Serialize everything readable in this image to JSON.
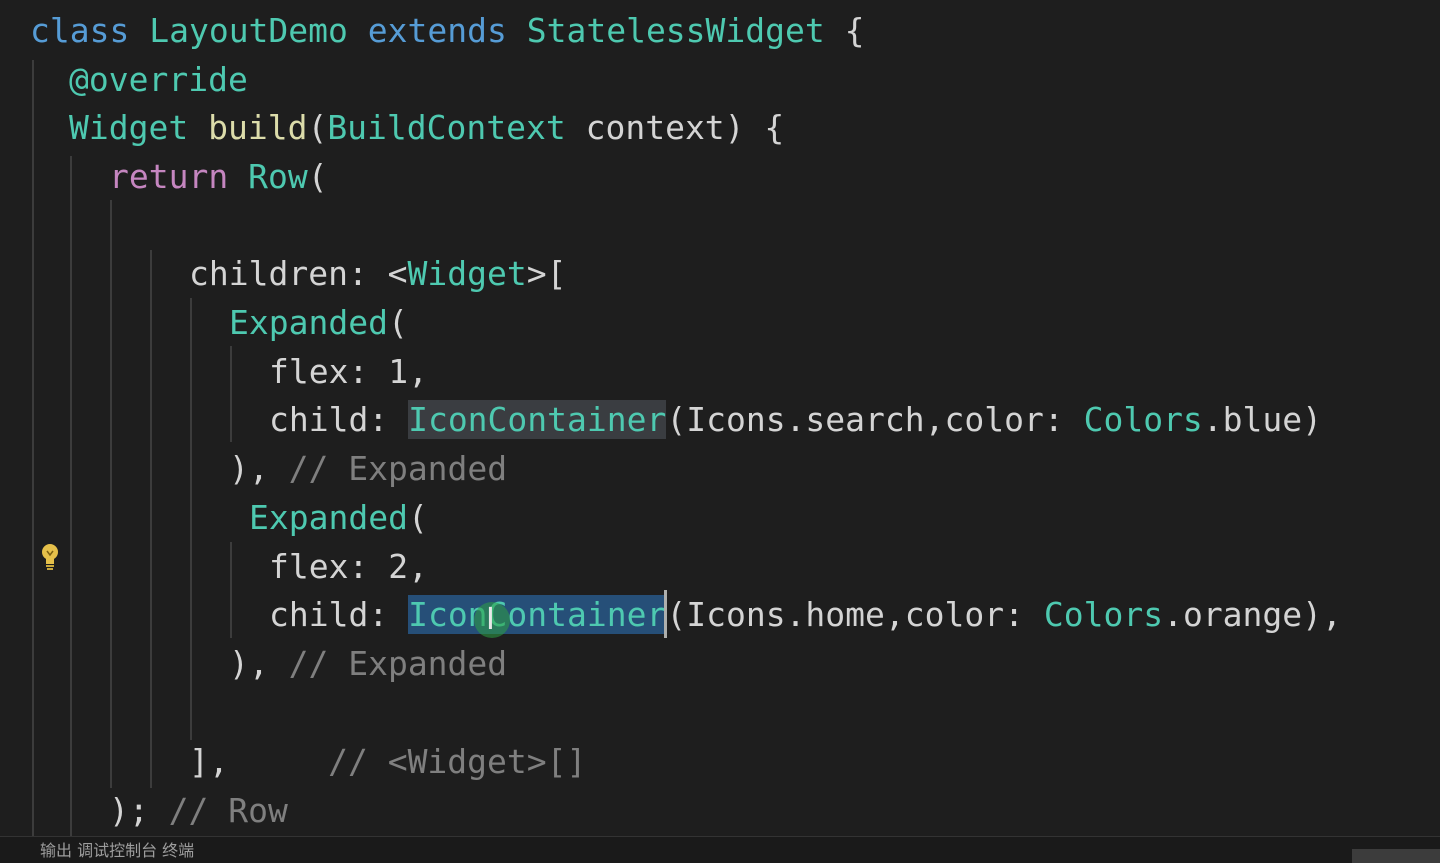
{
  "editor": {
    "language": "dart",
    "lines": [
      {
        "tokens": [
          "class",
          " ",
          "LayoutDemo",
          " ",
          "extends",
          " ",
          "StatelessWidget",
          " {"
        ]
      },
      {
        "tokens": [
          "@override"
        ]
      },
      {
        "tokens": [
          "Widget",
          " ",
          "build",
          "(",
          "BuildContext",
          " context) {"
        ]
      },
      {
        "tokens": [
          "return",
          " ",
          "Row",
          "("
        ]
      },
      {
        "tokens": []
      },
      {
        "tokens": [
          "children: <",
          "Widget",
          ">["
        ]
      },
      {
        "tokens": [
          "Expanded",
          "("
        ]
      },
      {
        "tokens": [
          "flex: 1,"
        ]
      },
      {
        "tokens": [
          "child: ",
          "IconContainer",
          "(Icons.search,color: ",
          "Colors",
          ".blue)"
        ]
      },
      {
        "tokens": [
          "), ",
          "// Expanded"
        ]
      },
      {
        "tokens": [
          "Expanded",
          "("
        ]
      },
      {
        "tokens": [
          "flex: 2,"
        ]
      },
      {
        "tokens": [
          "child: ",
          "IconContainer",
          "(Icons.home,color: ",
          "Colors",
          ".orange),"
        ]
      },
      {
        "tokens": [
          "), ",
          "// Expanded"
        ]
      },
      {
        "tokens": []
      },
      {
        "tokens": [
          "],",
          "     ",
          "// <Widget>[]"
        ]
      },
      {
        "tokens": [
          "); ",
          "// Row"
        ]
      }
    ],
    "selected_word": "IconContainer",
    "highlight_colors": {
      "selection": "#264f78",
      "word_highlight": "#3a3d41"
    }
  },
  "gutter": {
    "icon": "lightbulb-icon",
    "icon_color": "#e5c04a"
  },
  "statusbar": {
    "left_text": "输出    调试控制台    终端"
  }
}
